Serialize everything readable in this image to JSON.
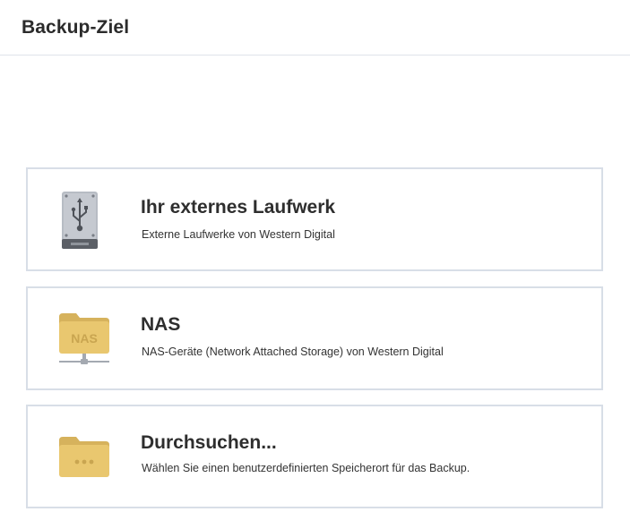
{
  "header": {
    "title": "Backup-Ziel"
  },
  "options": [
    {
      "title": "Ihr externes Laufwerk",
      "description": "Externe Laufwerke von Western Digital",
      "icon": "usb-drive-icon"
    },
    {
      "title": "NAS",
      "description": "NAS-Geräte (Network Attached Storage) von Western Digital",
      "icon": "nas-folder-icon",
      "icon_label": "NAS"
    },
    {
      "title": "Durchsuchen...",
      "description": "Wählen Sie einen benutzerdefinierten Speicherort für das Backup.",
      "icon": "browse-folder-icon"
    }
  ],
  "colors": {
    "folder": "#e7c46f",
    "folder_dark": "#d9b45e",
    "card_border": "#d8dee7",
    "drive_body": "#b9bec6"
  }
}
